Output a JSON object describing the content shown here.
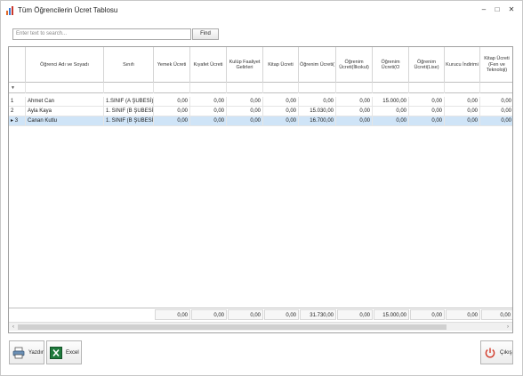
{
  "window": {
    "title": "Tüm Öğrencilerin Ücret Tablosu",
    "minimize": "–",
    "maximize": "□",
    "close": "✕"
  },
  "search": {
    "placeholder": "Enter text to search...",
    "find_label": "Find"
  },
  "grid": {
    "columns": [
      "Öğrenci Adı ve Soyadı",
      "Sınıfı",
      "Yemek Ücreti",
      "Kıyafet Ücreti",
      "Kulüp Faaliyet Gelirleri",
      "Kitap Ücreti",
      "Öğrenim Ücreti(",
      "Öğrenim Ücreti(İlkokul)",
      "Öğrenim Ücreti(O",
      "Öğrenim Ücreti(Lise)",
      "Kurucu İndirimi",
      "Kitap Ücreti (Fen ve Teknoloji)"
    ],
    "filter_icon": "▼",
    "rows": [
      {
        "index": "1",
        "marker": "",
        "cells": [
          "Ahmet Can",
          "1.SINIF (A ŞUBESİ)",
          "0,00",
          "0,00",
          "0,00",
          "0,00",
          "0,00",
          "0,00",
          "15.000,00",
          "0,00",
          "0,00",
          "0,00"
        ]
      },
      {
        "index": "2",
        "marker": "",
        "cells": [
          "Ayla Kaya",
          "1. SINIF (B ŞUBESİ)",
          "0,00",
          "0,00",
          "0,00",
          "0,00",
          "15.030,00",
          "0,00",
          "0,00",
          "0,00",
          "0,00",
          "0,00"
        ]
      },
      {
        "index": "3",
        "marker": "▸",
        "cells": [
          "Canan Kutlu",
          "1. SINIF (B ŞUBESİ)",
          "0,00",
          "0,00",
          "0,00",
          "0,00",
          "16.700,00",
          "0,00",
          "0,00",
          "0,00",
          "0,00",
          "0,00"
        ]
      }
    ],
    "totals": [
      "0,00",
      "0,00",
      "0,00",
      "0,00",
      "31.730,00",
      "0,00",
      "15.000,00",
      "0,00",
      "0,00",
      "0,00"
    ],
    "scroll_left": "‹",
    "scroll_right": "›"
  },
  "buttons": {
    "print_label": "Yazdır",
    "excel_label": "Excel",
    "exit_label": "Çıkış"
  },
  "colors": {
    "selected_row": "#cfe4f7",
    "excel_green": "#1f7a3c",
    "exit_red": "#d23a2a"
  }
}
